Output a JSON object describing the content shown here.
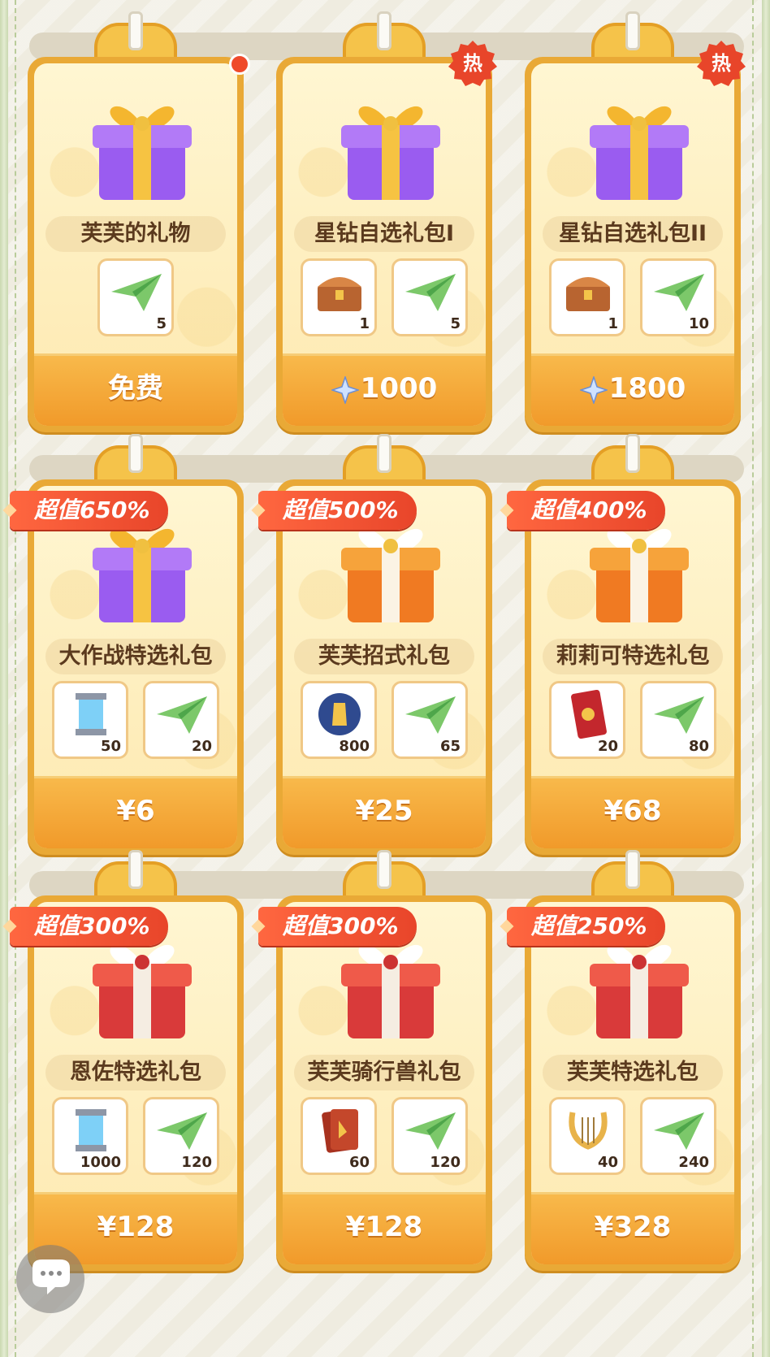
{
  "rows": [
    {
      "cards": [
        {
          "name": "芙芙的礼物",
          "gift": "purple-gift",
          "badge": "red-dot",
          "ribbon": "",
          "items": [
            {
              "icon": "paper-plane-icon",
              "count": "5"
            }
          ],
          "price": "免费",
          "currency": ""
        },
        {
          "name": "星钻自选礼包I",
          "gift": "purple-gift",
          "badge": "hot",
          "ribbon": "",
          "items": [
            {
              "icon": "treasure-chest-icon",
              "count": "1"
            },
            {
              "icon": "paper-plane-icon",
              "count": "5"
            }
          ],
          "price": "1000",
          "currency": "star-diamond-icon"
        },
        {
          "name": "星钻自选礼包II",
          "gift": "purple-gift",
          "badge": "hot",
          "ribbon": "",
          "items": [
            {
              "icon": "treasure-chest-icon",
              "count": "1"
            },
            {
              "icon": "paper-plane-icon",
              "count": "10"
            }
          ],
          "price": "1800",
          "currency": "star-diamond-icon"
        }
      ]
    },
    {
      "cards": [
        {
          "name": "大作战特选礼包",
          "gift": "purple-gift",
          "badge": "",
          "ribbon": "超值650%",
          "items": [
            {
              "icon": "energy-canister-icon",
              "count": "50"
            },
            {
              "icon": "paper-plane-icon",
              "count": "20"
            }
          ],
          "price": "¥6",
          "currency": ""
        },
        {
          "name": "芙芙招式礼包",
          "gift": "orange-gift",
          "badge": "",
          "ribbon": "超值500%",
          "items": [
            {
              "icon": "crystal-orb-icon",
              "count": "800"
            },
            {
              "icon": "paper-plane-icon",
              "count": "65"
            }
          ],
          "price": "¥25",
          "currency": ""
        },
        {
          "name": "莉莉可特选礼包",
          "gift": "orange-gift",
          "badge": "",
          "ribbon": "超值400%",
          "items": [
            {
              "icon": "red-card-icon",
              "count": "20"
            },
            {
              "icon": "paper-plane-icon",
              "count": "80"
            }
          ],
          "price": "¥68",
          "currency": ""
        }
      ]
    },
    {
      "cards": [
        {
          "name": "恩佐特选礼包",
          "gift": "red-gift",
          "badge": "",
          "ribbon": "超值300%",
          "items": [
            {
              "icon": "energy-canister-icon",
              "count": "1000"
            },
            {
              "icon": "paper-plane-icon",
              "count": "120"
            }
          ],
          "price": "¥128",
          "currency": ""
        },
        {
          "name": "芙芙骑行兽礼包",
          "gift": "red-gift",
          "badge": "",
          "ribbon": "超值300%",
          "items": [
            {
              "icon": "book-cards-icon",
              "count": "60"
            },
            {
              "icon": "paper-plane-icon",
              "count": "120"
            }
          ],
          "price": "¥128",
          "currency": ""
        },
        {
          "name": "芙芙特选礼包",
          "gift": "red-gift",
          "badge": "",
          "ribbon": "超值250%",
          "items": [
            {
              "icon": "lyre-icon",
              "count": "40"
            },
            {
              "icon": "paper-plane-icon",
              "count": "240"
            }
          ],
          "price": "¥328",
          "currency": ""
        }
      ]
    }
  ],
  "badge_hot_label": "热",
  "colors": {
    "accent": "#f19a2a",
    "hot": "#e8452a",
    "purple": "#8e55e0",
    "gold": "#f3b93a"
  }
}
